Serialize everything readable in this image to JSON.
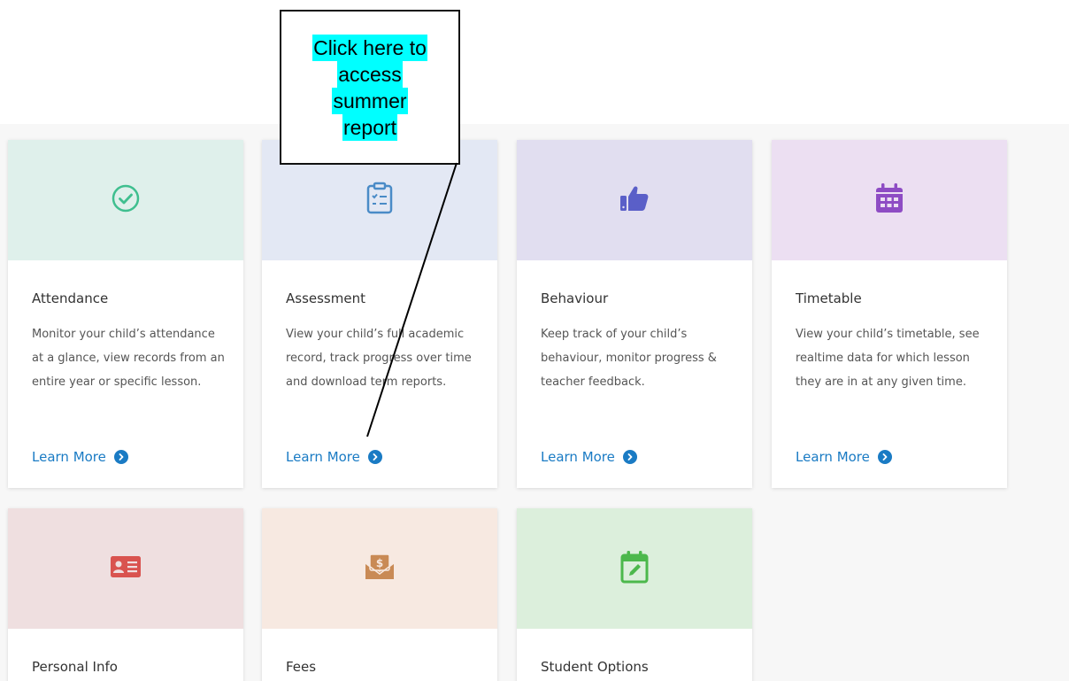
{
  "cards": [
    {
      "title": "Attendance",
      "description": "Monitor your child’s attendance at a glance, view records from an entire year or specific lesson.",
      "link": "Learn More",
      "icon": "check-circle-icon",
      "bg": "#dff0eb",
      "icon_color": "#3fbf8f"
    },
    {
      "title": "Assessment",
      "description": "View your child’s full academic record, track progress over time and download term reports.",
      "link": "Learn More",
      "icon": "clipboard-icon",
      "bg": "#e3e8f4",
      "icon_color": "#4a8bc7"
    },
    {
      "title": "Behaviour",
      "description": "Keep track of your child’s behaviour, monitor progress & teacher feedback.",
      "link": "Learn More",
      "icon": "thumbs-up-icon",
      "bg": "#e1def0",
      "icon_color": "#5a5fc8"
    },
    {
      "title": "Timetable",
      "description": "View your child’s timetable, see realtime data for which lesson they are in at any given time.",
      "link": "Learn More",
      "icon": "calendar-icon",
      "bg": "#ecdff2",
      "icon_color": "#8e4cc4"
    },
    {
      "title": "Personal Info",
      "icon": "id-card-icon",
      "bg": "#efdfe0",
      "icon_color": "#d9534f"
    },
    {
      "title": "Fees",
      "icon": "money-envelope-icon",
      "bg": "#f7e9e1",
      "icon_color": "#c98a55"
    },
    {
      "title": "Student Options",
      "icon": "calendar-edit-icon",
      "bg": "#dcefdc",
      "icon_color": "#4cb84c"
    }
  ],
  "callout": {
    "lines": [
      "Click here to",
      "access",
      "summer",
      "report"
    ],
    "highlight_color": "#00ffff"
  },
  "link_color": "#1a7bc4"
}
